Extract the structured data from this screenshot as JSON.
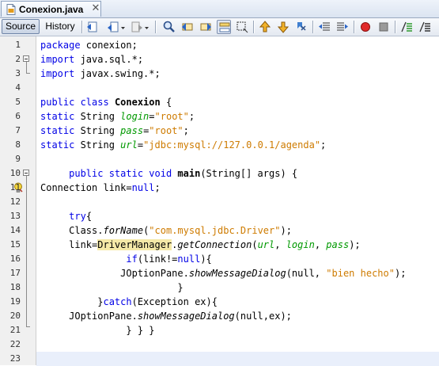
{
  "tab": {
    "title": "Conexion.java",
    "close": "✕",
    "icon": "java-file-icon"
  },
  "toolbar": {
    "source_label": "Source",
    "history_label": "History",
    "icons": [
      "last-edit-icon",
      "back-icon",
      "forward-icon",
      "find-icon",
      "find-previous-icon",
      "find-next-icon",
      "find-selection-icon",
      "highlight-toggle-icon",
      "rectangular-selection-icon",
      "previous-bookmark-icon",
      "next-bookmark-icon",
      "toggle-bookmark-icon",
      "shift-left-icon",
      "shift-right-icon",
      "start-macro-icon",
      "stop-macro-icon",
      "comment-icon",
      "uncomment-icon"
    ]
  },
  "colors": {
    "keyword": "#0000e6",
    "string": "#ce7b00",
    "field": "#009900",
    "current_line": "#e9effb",
    "gutter": "#f0f0f0"
  },
  "editor": {
    "line_numbers": [
      "1",
      "2",
      "3",
      "4",
      "5",
      "6",
      "7",
      "8",
      "9",
      "10",
      "11",
      "12",
      "13",
      "14",
      "15",
      "16",
      "17",
      "18",
      "19",
      "20",
      "21",
      "22",
      "23"
    ],
    "current_line": 23,
    "lines": [
      {
        "indent": "",
        "tokens": [
          {
            "t": "package",
            "c": "kw"
          },
          {
            "t": " conexion;"
          }
        ]
      },
      {
        "indent": "",
        "tokens": [
          {
            "t": "import",
            "c": "kw"
          },
          {
            "t": " java.sql.*;"
          }
        ]
      },
      {
        "indent": "",
        "tokens": [
          {
            "t": "import",
            "c": "kw"
          },
          {
            "t": " javax.swing.*;"
          }
        ]
      },
      {
        "indent": "",
        "tokens": []
      },
      {
        "indent": "",
        "tokens": [
          {
            "t": "public class",
            "c": "kw"
          },
          {
            "t": " "
          },
          {
            "t": "Conexion",
            "c": "bld"
          },
          {
            "t": " {"
          }
        ]
      },
      {
        "indent": "",
        "tokens": [
          {
            "t": "static",
            "c": "kw"
          },
          {
            "t": " String "
          },
          {
            "t": "login",
            "c": "fld"
          },
          {
            "t": "="
          },
          {
            "t": "\"root\"",
            "c": "str"
          },
          {
            "t": ";"
          }
        ]
      },
      {
        "indent": "",
        "tokens": [
          {
            "t": "static",
            "c": "kw"
          },
          {
            "t": " String "
          },
          {
            "t": "pass",
            "c": "fld"
          },
          {
            "t": "="
          },
          {
            "t": "\"root\"",
            "c": "str"
          },
          {
            "t": ";"
          }
        ]
      },
      {
        "indent": "",
        "tokens": [
          {
            "t": "static",
            "c": "kw"
          },
          {
            "t": " String "
          },
          {
            "t": "url",
            "c": "fld"
          },
          {
            "t": "="
          },
          {
            "t": "\"jdbc:mysql://127.0.0.1/agenda\"",
            "c": "str"
          },
          {
            "t": ";"
          }
        ]
      },
      {
        "indent": "",
        "tokens": []
      },
      {
        "indent": "     ",
        "tokens": [
          {
            "t": "public static void",
            "c": "kw"
          },
          {
            "t": " "
          },
          {
            "t": "main",
            "c": "bld"
          },
          {
            "t": "(String[] args) {"
          }
        ]
      },
      {
        "indent": "",
        "tokens": [
          {
            "t": "Connection link="
          },
          {
            "t": "null",
            "c": "kw"
          },
          {
            "t": ";"
          }
        ]
      },
      {
        "indent": "",
        "tokens": []
      },
      {
        "indent": "     ",
        "tokens": [
          {
            "t": "try",
            "c": "kw"
          },
          {
            "t": "{"
          }
        ]
      },
      {
        "indent": "     ",
        "tokens": [
          {
            "t": "Class."
          },
          {
            "t": "forName",
            "c": "itl"
          },
          {
            "t": "("
          },
          {
            "t": "\"com.mysql.jdbc.Driver\"",
            "c": "str"
          },
          {
            "t": ");"
          }
        ]
      },
      {
        "indent": "     ",
        "tokens": [
          {
            "t": "link="
          },
          {
            "t": "DriverManager",
            "c": "mark"
          },
          {
            "t": "."
          },
          {
            "t": "getConnection",
            "c": "itl"
          },
          {
            "t": "("
          },
          {
            "t": "url",
            "c": "fld"
          },
          {
            "t": ", "
          },
          {
            "t": "login",
            "c": "fld"
          },
          {
            "t": ", "
          },
          {
            "t": "pass",
            "c": "fld"
          },
          {
            "t": ");"
          }
        ]
      },
      {
        "indent": "               ",
        "tokens": [
          {
            "t": "if",
            "c": "kw"
          },
          {
            "t": "(link!="
          },
          {
            "t": "null",
            "c": "kw"
          },
          {
            "t": "){"
          }
        ]
      },
      {
        "indent": "              ",
        "tokens": [
          {
            "t": "JOptionPane."
          },
          {
            "t": "showMessageDialog",
            "c": "itl"
          },
          {
            "t": "(null, "
          },
          {
            "t": "\"bien hecho\"",
            "c": "str"
          },
          {
            "t": ");"
          }
        ]
      },
      {
        "indent": "                        ",
        "tokens": [
          {
            "t": "}"
          }
        ]
      },
      {
        "indent": "          ",
        "tokens": [
          {
            "t": "}"
          },
          {
            "t": "catch",
            "c": "kw"
          },
          {
            "t": "(Exception ex){"
          }
        ]
      },
      {
        "indent": "     ",
        "tokens": [
          {
            "t": "JOptionPane."
          },
          {
            "t": "showMessageDialog",
            "c": "itl"
          },
          {
            "t": "(null,ex);"
          }
        ]
      },
      {
        "indent": "               ",
        "tokens": [
          {
            "t": "} } }"
          }
        ]
      },
      {
        "indent": "",
        "tokens": []
      },
      {
        "indent": "",
        "tokens": []
      }
    ]
  }
}
